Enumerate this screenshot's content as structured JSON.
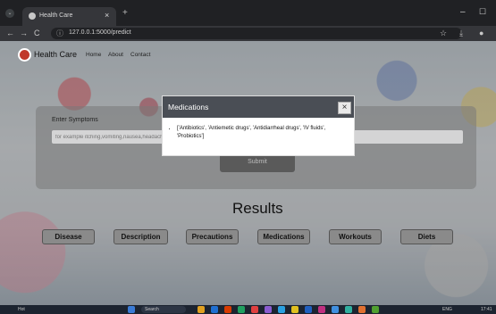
{
  "browser": {
    "tab_title": "Health Care",
    "tab_close": "×",
    "new_tab": "+",
    "url": "127.0.0.1:5000/predict",
    "back": "←",
    "forward": "→",
    "reload": "C",
    "star": "☆",
    "minimize": "–",
    "maximize": "☐"
  },
  "nav": {
    "brand": "Health Care",
    "links": [
      "Home",
      "About",
      "Contact"
    ]
  },
  "form": {
    "label": "Enter Symptoms",
    "placeholder": "for example itching,vomiting,nausea,headache,cough etc...",
    "submit": "Submit"
  },
  "results": {
    "title": "Results",
    "buttons": [
      "Disease",
      "Description",
      "Precautions",
      "Medications",
      "Workouts",
      "Diets"
    ]
  },
  "modal": {
    "title": "Medications",
    "close": "×",
    "items": [
      "['Antibiotics', 'Antiemetic drugs', 'Antidiarrheal drugs', 'IV fluids', 'Probiotics']"
    ]
  },
  "taskbar": {
    "weather": "Hot",
    "search": "Search",
    "lang": "ENG",
    "time": "17:41"
  },
  "colors": {
    "modal_header": "#4a4e55",
    "submit_button": "#5a5a5a",
    "result_button": "#8a8a8a"
  }
}
